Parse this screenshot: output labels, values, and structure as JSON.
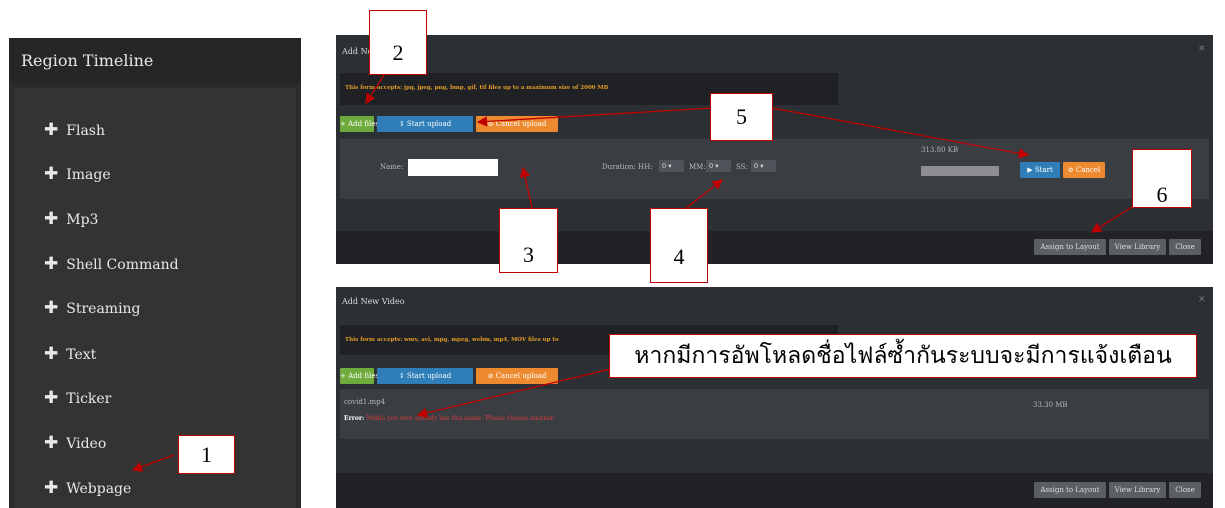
{
  "timeline": {
    "title": "Region Timeline",
    "items": [
      "Flash",
      "Image",
      "Mp3",
      "Shell Command",
      "Streaming",
      "Text",
      "Ticker",
      "Video",
      "Webpage"
    ]
  },
  "top_dialog": {
    "title": "Add Ne",
    "note": "This form accepts: jpg, jpeg, png, bmp, gif, tif files up to a maximum size of 2000 MB",
    "add_files": "+ Add files",
    "start_upload": "Start upload",
    "cancel_upload": "Cancel upload",
    "name_label": "Name:",
    "name_value": "",
    "duration_label": "Duration: HH:",
    "hh_value": "0",
    "mm_label": "MM:",
    "mm_value": "0",
    "ss_label": "SS:",
    "ss_value": "0",
    "file_size": "313.80 KB",
    "start": "Start",
    "cancel": "Cancel",
    "assign": "Assign to Layout",
    "view_library": "View Library",
    "close": "Close"
  },
  "bottom_dialog": {
    "title": "Add New Video",
    "note": "This form accepts: wmv, avi, mpg, mpeg, webm, mp4, MOV files up to",
    "add_files": "+ Add files",
    "start_upload": "Start upload",
    "cancel_upload": "Cancel upload",
    "file_name": "covid1.mp4",
    "error_label": "Error:",
    "error_text": "Media you own already has this name. Please choose another.",
    "file_size": "33.30 MB",
    "assign": "Assign to Layout",
    "view_library": "View Library",
    "close": "Close"
  },
  "callouts": {
    "c1": "1",
    "c2": "2",
    "c3": "3",
    "c4": "4",
    "c5": "5",
    "c6": "6",
    "thai": "หากมีการอัพโหลดชื่อไฟล์ซ้ำกันระบบจะมีการแจ้งเตือน"
  },
  "colors": {
    "annotation": "#c00000",
    "green": "#6faa3c",
    "blue": "#2f7eb8",
    "orange": "#ed8a30"
  }
}
